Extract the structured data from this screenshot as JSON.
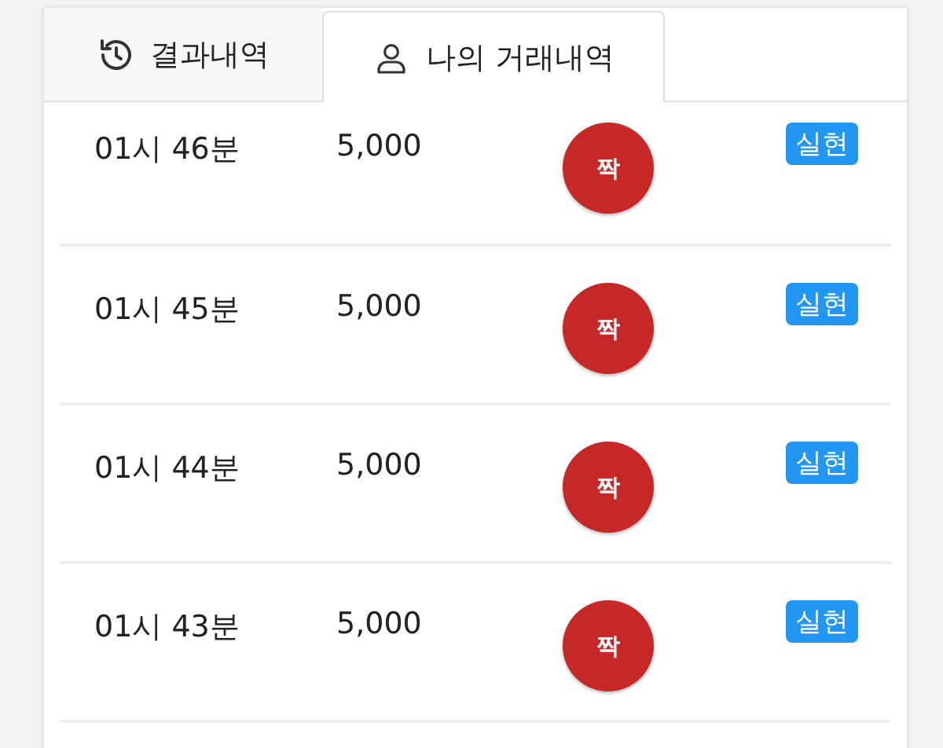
{
  "tabs": [
    {
      "label": "결과내역",
      "kind": "history",
      "selected": false
    },
    {
      "label": "나의 거래내역",
      "kind": "person",
      "selected": true
    }
  ],
  "rows": [
    {
      "time": "01시 46분",
      "amount": "5,000",
      "pick": "짝",
      "color": "#c62828",
      "status": "실현"
    },
    {
      "time": "01시 45분",
      "amount": "5,000",
      "pick": "짝",
      "color": "#c62828",
      "status": "실현"
    },
    {
      "time": "01시 44분",
      "amount": "5,000",
      "pick": "짝",
      "color": "#c62828",
      "status": "실현"
    },
    {
      "time": "01시 43분",
      "amount": "5,000",
      "pick": "짝",
      "color": "#c62828",
      "status": "실현"
    }
  ]
}
